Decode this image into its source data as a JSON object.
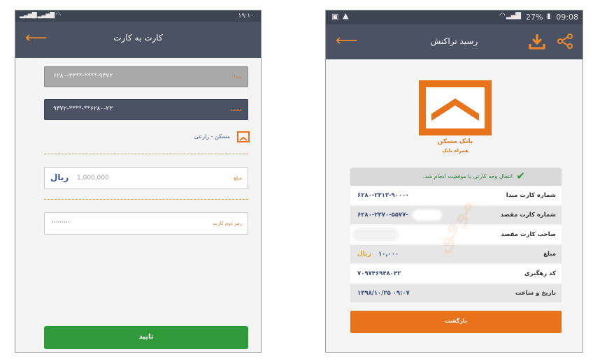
{
  "left": {
    "status_time": "۱۹:۱۰",
    "title": "کارت به کارت",
    "source_label": "مبدا",
    "source_value": "۶۲۸۰-۲۳**-****-۹۳۷۲",
    "dest_label": "مقصد",
    "dest_value": "۹۳۷۲-****-**۶۲۸۰-۲۳",
    "dest_owner": "مسکن - زارعی",
    "amount_label": "مبلغ",
    "amount_placeholder": "1,000,000",
    "currency": "ریال",
    "pin_label": "رمز دوم کارت",
    "pin_value": "·········",
    "confirm_label": "تایید"
  },
  "right": {
    "status_battery": "27%",
    "status_time": "09:08",
    "title": "رسید تراکنش",
    "bank_name": "بانک مسکن",
    "bank_sub": "همراه بانک",
    "success_text": "انتقال وجه کارتی با موفقیت انجام شد.",
    "rows": [
      {
        "label": "شماره کارت مبدا",
        "value": "۶۲۸۰-۲۳۱۳-۹۰۰۰-"
      },
      {
        "label": "شماره کارت مقصد",
        "value": "۶۲۸۰-۲۳۷۰-۵۵۷۷-"
      },
      {
        "label": "صاحب کارت مقصد",
        "value": ""
      },
      {
        "label": "مبلغ",
        "value": "۱۰,۰۰۰",
        "unit": "ریال"
      },
      {
        "label": "کد رهگیری",
        "value": "۷۰۹۷۴۶۹۴۸۰۴۲"
      },
      {
        "label": "تاریخ و ساعت",
        "value": "۱۳۹۸/۱۰/۲۵  ۰۹:۰۷"
      }
    ],
    "watermark": "موفق",
    "back_label": "بازگشت"
  },
  "colors": {
    "orange": "#e8731a",
    "appbar": "#4a5264",
    "green": "#2ea043"
  }
}
